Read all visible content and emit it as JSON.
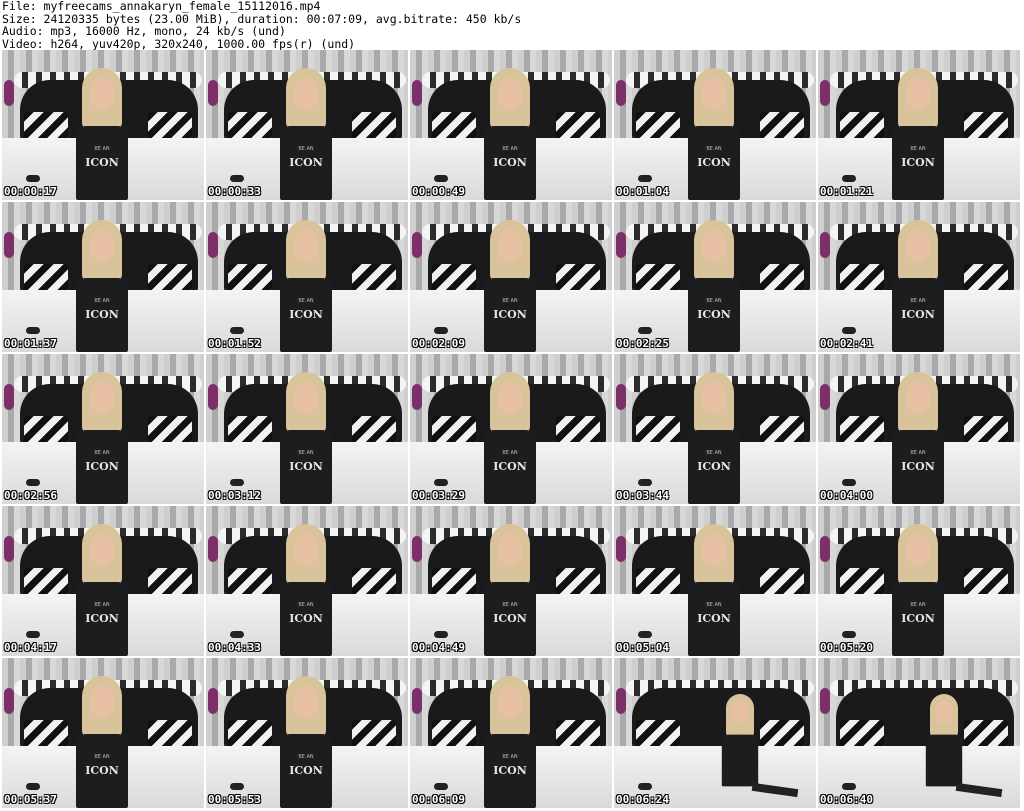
{
  "header": {
    "file_line": "File: myfreecams_annakaryn_female_15112016.mp4",
    "size_line": "Size: 24120335 bytes (23.00 MiB), duration: 00:07:09, avg.bitrate: 450 kb/s",
    "audio_line": "Audio: mp3, 16000 Hz, mono, 24 kb/s (und)",
    "video_line": "Video: h264, yuv420p, 320x240, 1000.00 fps(r) (und)"
  },
  "thumbnails": [
    {
      "timestamp": "00:00:17",
      "shirt_small": "BE AN",
      "shirt_text": "ICON"
    },
    {
      "timestamp": "00:00:33",
      "shirt_small": "BE AN",
      "shirt_text": "ICON"
    },
    {
      "timestamp": "00:00:49",
      "shirt_small": "BE AN",
      "shirt_text": "ICON"
    },
    {
      "timestamp": "00:01:04",
      "shirt_small": "BE AN",
      "shirt_text": "ICON"
    },
    {
      "timestamp": "00:01:21",
      "shirt_small": "BE AN",
      "shirt_text": "ICON"
    },
    {
      "timestamp": "00:01:37",
      "shirt_small": "BE AN",
      "shirt_text": "ICON"
    },
    {
      "timestamp": "00:01:52",
      "shirt_small": "BE AN",
      "shirt_text": "ICON"
    },
    {
      "timestamp": "00:02:09",
      "shirt_small": "BE AN",
      "shirt_text": "ICON"
    },
    {
      "timestamp": "00:02:25",
      "shirt_small": "BE AN",
      "shirt_text": "ICON"
    },
    {
      "timestamp": "00:02:41",
      "shirt_small": "BE AN",
      "shirt_text": "ICON"
    },
    {
      "timestamp": "00:02:56",
      "shirt_small": "BE AN",
      "shirt_text": "ICON"
    },
    {
      "timestamp": "00:03:12",
      "shirt_small": "BE AN",
      "shirt_text": "ICON"
    },
    {
      "timestamp": "00:03:29",
      "shirt_small": "BE AN",
      "shirt_text": "ICON"
    },
    {
      "timestamp": "00:03:44",
      "shirt_small": "BE AN",
      "shirt_text": "ICON"
    },
    {
      "timestamp": "00:04:00",
      "shirt_small": "BE AN",
      "shirt_text": "ICON"
    },
    {
      "timestamp": "00:04:17",
      "shirt_small": "BE AN",
      "shirt_text": "ICON"
    },
    {
      "timestamp": "00:04:33",
      "shirt_small": "BE AN",
      "shirt_text": "ICON"
    },
    {
      "timestamp": "00:04:49",
      "shirt_small": "BE AN",
      "shirt_text": "ICON"
    },
    {
      "timestamp": "00:05:04",
      "shirt_small": "BE AN",
      "shirt_text": "ICON"
    },
    {
      "timestamp": "00:05:20",
      "shirt_small": "BE AN",
      "shirt_text": "ICON"
    },
    {
      "timestamp": "00:05:37",
      "shirt_small": "BE AN",
      "shirt_text": "ICON"
    },
    {
      "timestamp": "00:05:53",
      "shirt_small": "BE AN",
      "shirt_text": "ICON"
    },
    {
      "timestamp": "00:06:09",
      "shirt_small": "BE AN",
      "shirt_text": "ICON"
    },
    {
      "timestamp": "00:06:24",
      "shirt_small": "",
      "shirt_text": ""
    },
    {
      "timestamp": "00:06:40",
      "shirt_small": "",
      "shirt_text": ""
    }
  ],
  "colors": {
    "timestamp_text": "#ffffff",
    "timestamp_outline": "#000000",
    "page_background": "#ffffff"
  }
}
